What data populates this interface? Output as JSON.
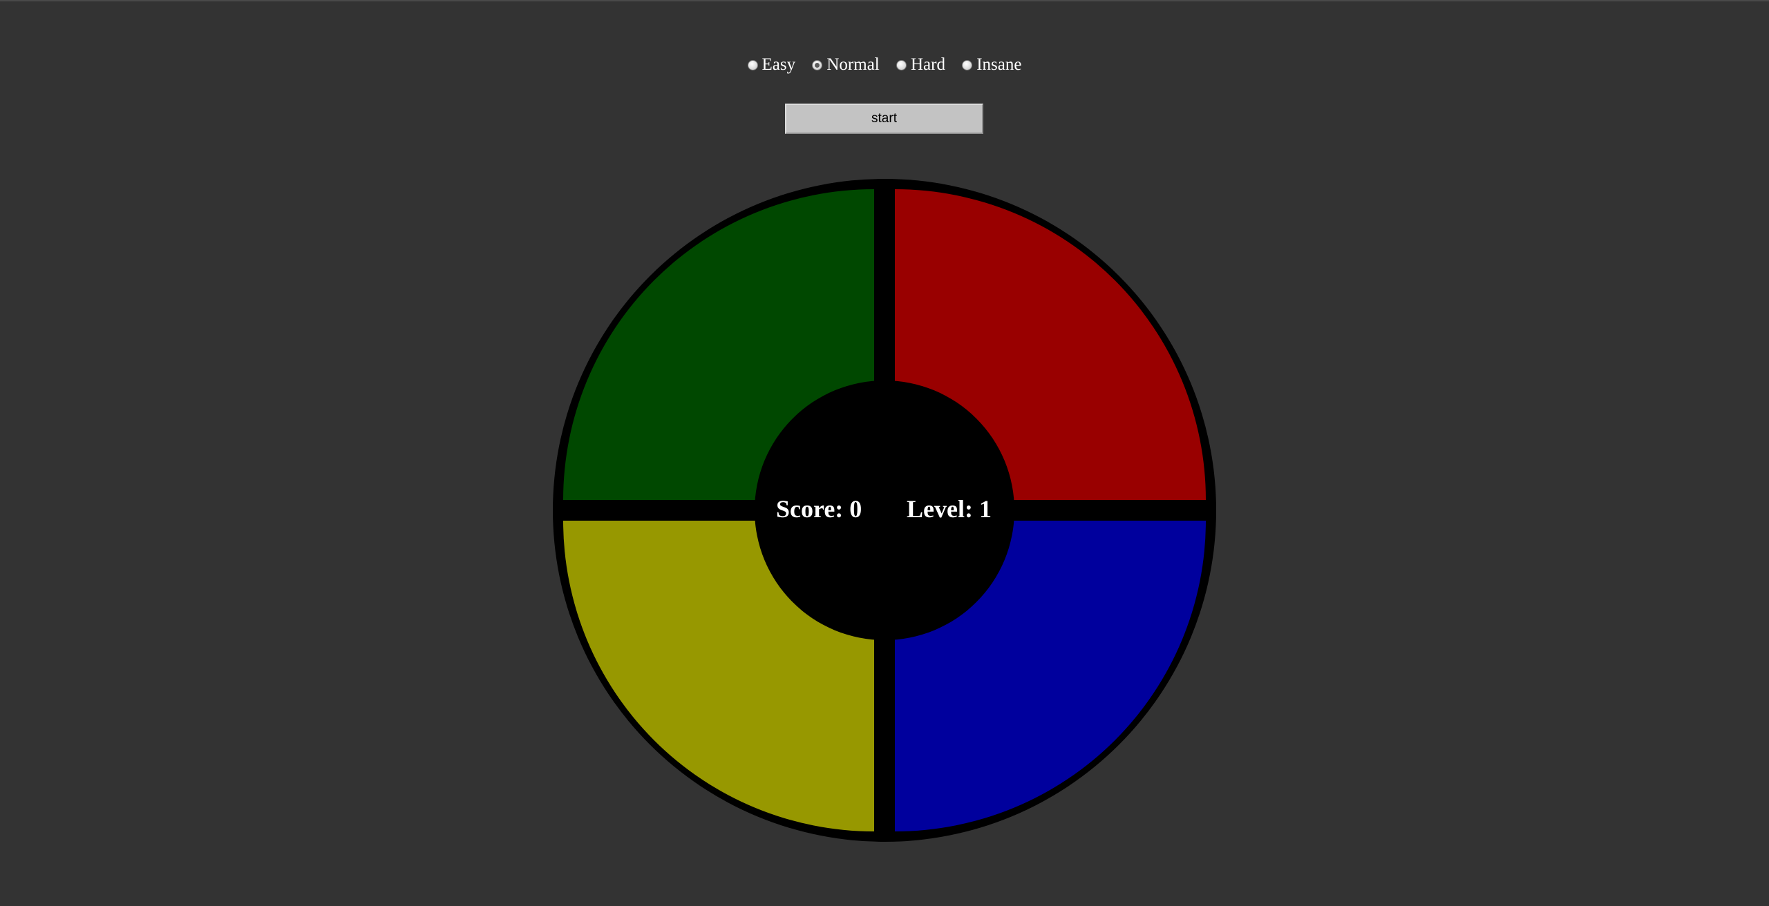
{
  "difficulty": {
    "options": [
      {
        "label": "Easy",
        "selected": false
      },
      {
        "label": "Normal",
        "selected": true
      },
      {
        "label": "Hard",
        "selected": false
      },
      {
        "label": "Insane",
        "selected": false
      }
    ]
  },
  "controls": {
    "start_label": "start"
  },
  "board": {
    "pads": [
      {
        "name": "green",
        "color": "#004800"
      },
      {
        "name": "red",
        "color": "#990000"
      },
      {
        "name": "yellow",
        "color": "#979800"
      },
      {
        "name": "blue",
        "color": "#00009d"
      }
    ],
    "score_label": "Score: 0",
    "level_label": "Level: 1"
  }
}
